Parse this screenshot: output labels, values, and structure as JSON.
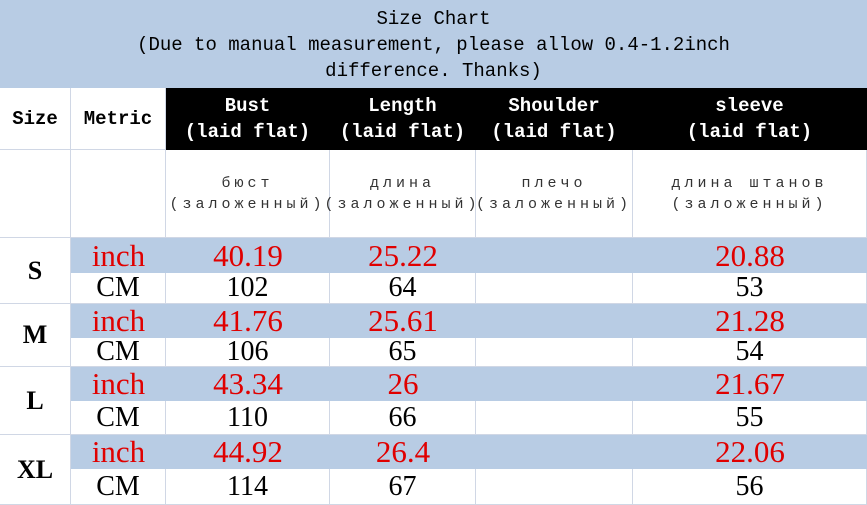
{
  "title": {
    "line1": "Size Chart",
    "line2": "(Due to manual measurement, please allow 0.4-1.2inch",
    "line3": "difference. Thanks)"
  },
  "headers": {
    "size": "Size",
    "metric": "Metric",
    "columns": [
      {
        "en": "Bust",
        "sub": "(laid flat)",
        "ru": "бюст (заложенный)"
      },
      {
        "en": "Length",
        "sub": "(laid flat)",
        "ru": "длина (заложенный)"
      },
      {
        "en": "Shoulder",
        "sub": "(laid flat)",
        "ru": "плечо (заложенный)"
      },
      {
        "en": "sleeve",
        "sub": "(laid flat)",
        "ru": "длина штанов (заложенный)"
      }
    ]
  },
  "units": {
    "inch": "inch",
    "cm": "CM"
  },
  "rows": [
    {
      "size": "S",
      "inch": [
        "40.19",
        "25.22",
        "",
        "20.88"
      ],
      "cm": [
        "102",
        "64",
        "",
        "53"
      ]
    },
    {
      "size": "M",
      "inch": [
        "41.76",
        "25.61",
        "",
        "21.28"
      ],
      "cm": [
        "106",
        "65",
        "",
        "54"
      ]
    },
    {
      "size": "L",
      "inch": [
        "43.34",
        "26",
        "",
        "21.67"
      ],
      "cm": [
        "110",
        "66",
        "",
        "55"
      ]
    },
    {
      "size": "XL",
      "inch": [
        "44.92",
        "26.4",
        "",
        "22.06"
      ],
      "cm": [
        "114",
        "67",
        "",
        "56"
      ]
    }
  ],
  "colors": {
    "band": "#b8cce4",
    "inch_text": "#e00000",
    "header_bg": "#000000"
  }
}
